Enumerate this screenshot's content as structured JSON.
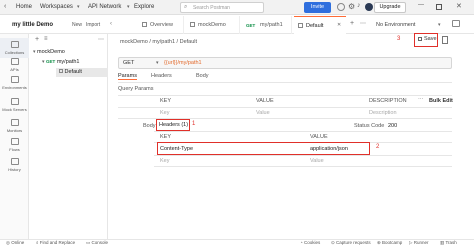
{
  "topbar": {
    "home": "Home",
    "workspaces": "Workspaces",
    "api_network": "API Network",
    "explore": "Explore",
    "search_placeholder": "Search Postman",
    "invite": "Invite",
    "upgrade": "Upgrade"
  },
  "workspace": {
    "name": "my little Demo",
    "new_button": "New",
    "import_button": "Import"
  },
  "tabs": [
    {
      "label": "Overview"
    },
    {
      "label": "mockDemo"
    },
    {
      "label": "my/path1"
    },
    {
      "label": "Default"
    }
  ],
  "environment": "No Environment",
  "rail": [
    {
      "label": "Collections"
    },
    {
      "label": "APIs"
    },
    {
      "label": "Environments"
    },
    {
      "label": "Mock Servers"
    },
    {
      "label": "Monitors"
    },
    {
      "label": "Flows"
    },
    {
      "label": "History"
    }
  ],
  "tree": {
    "collection": "mockDemo",
    "request_method": "GET",
    "request_name": "my/path1",
    "example": "Default"
  },
  "main": {
    "breadcrumb": "mockDemo / my/path1 / Default",
    "save": "Save",
    "method": "GET",
    "url": "{{url}}/my/path1",
    "request_tabs": [
      "Params",
      "Headers",
      "Body"
    ],
    "query_params": "Query Params",
    "col_key": "KEY",
    "col_value": "VALUE",
    "col_description": "DESCRIPTION",
    "bulk_edit": "Bulk Edit",
    "ph_key": "Key",
    "ph_value": "Value",
    "ph_description": "Description",
    "response_body": "Body",
    "response_headers": "Headers (1)",
    "status_code_label": "Status Code",
    "status_code": "200",
    "header_key": "Content-Type",
    "header_value": "application/json"
  },
  "annotations": {
    "one": "1",
    "two": "2",
    "three": "3"
  },
  "statusbar": {
    "online": "Online",
    "find_replace": "Find and Replace",
    "console": "Console",
    "cookies": "Cookies",
    "capture": "Capture requests",
    "bootcamp": "Bootcamp",
    "runner": "Runner",
    "trash": "Trash"
  },
  "colors": {
    "accent": "#ff6c37",
    "primary": "#2f6fde",
    "annotation": "#e0302a",
    "get": "#0c8e45"
  }
}
